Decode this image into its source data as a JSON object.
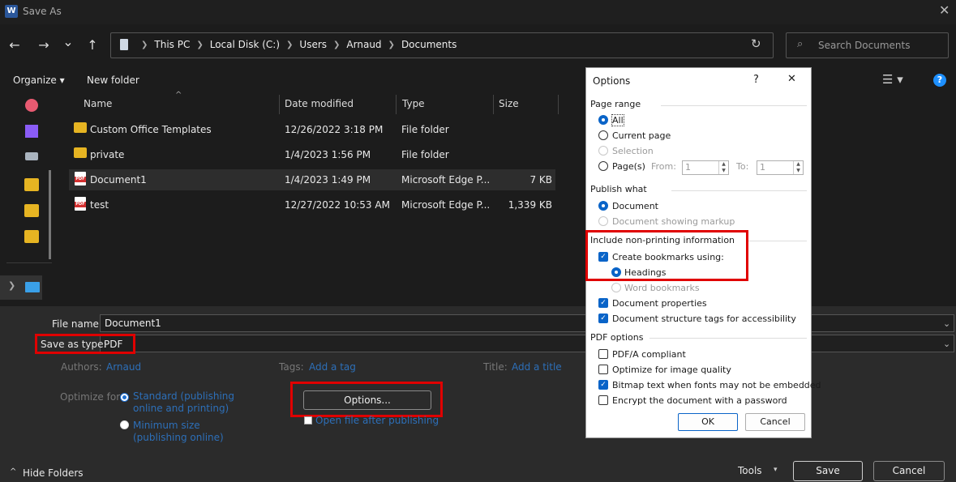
{
  "window": {
    "title": "Save As",
    "app_icon": "W"
  },
  "nav": {
    "back": "←",
    "forward": "→",
    "recent": "⌄",
    "up": "↑"
  },
  "address": {
    "crumbs": [
      "This PC",
      "Local Disk (C:)",
      "Users",
      "Arnaud",
      "Documents"
    ]
  },
  "search": {
    "placeholder": "Search Documents"
  },
  "toolbar": {
    "organize": "Organize ▾",
    "new_folder": "New folder"
  },
  "columns": {
    "name": "Name",
    "date": "Date modified",
    "type": "Type",
    "size": "Size"
  },
  "files": [
    {
      "name": "Custom Office Templates",
      "date": "12/26/2022 3:18 PM",
      "type": "File folder",
      "size": "",
      "icon": "folder-icon"
    },
    {
      "name": "private",
      "date": "1/4/2023 1:56 PM",
      "type": "File folder",
      "size": "",
      "icon": "folder-icon"
    },
    {
      "name": "Document1",
      "date": "1/4/2023 1:49 PM",
      "type": "Microsoft Edge P...",
      "size": "7 KB",
      "icon": "pdf-icon"
    },
    {
      "name": "test",
      "date": "12/27/2022 10:53 AM",
      "type": "Microsoft Edge P...",
      "size": "1,339 KB",
      "icon": "pdf-icon"
    }
  ],
  "form": {
    "file_name_label": "File name:",
    "file_name_value": "Document1",
    "save_type_label": "Save as type:",
    "save_type_value": "PDF",
    "authors_label": "Authors:",
    "authors_value": "Arnaud",
    "tags_label": "Tags:",
    "tags_value": "Add a tag",
    "title_label": "Title:",
    "title_value": "Add a title",
    "optimize_label": "Optimize for:",
    "optimize_standard_1": "Standard (publishing",
    "optimize_standard_2": "online and printing)",
    "optimize_min_1": "Minimum size",
    "optimize_min_2": "(publishing online)",
    "options_button": "Options...",
    "open_after": "Open file after publishing"
  },
  "footer": {
    "hide_folders": "Hide Folders",
    "tools": "Tools",
    "save": "Save",
    "cancel": "Cancel"
  },
  "options_dialog": {
    "title": "Options",
    "help": "?",
    "close": "✕",
    "page_range_head": "Page range",
    "all": "All",
    "current_page": "Current page",
    "selection": "Selection",
    "pages": "Page(s)",
    "from_label": "From:",
    "from_value": "1",
    "to_label": "To:",
    "to_value": "1",
    "publish_what_head": "Publish what",
    "document": "Document",
    "document_markup": "Document showing markup",
    "nonprinting_head": "Include non-printing information",
    "create_bookmarks": "Create bookmarks using:",
    "headings": "Headings",
    "word_bookmarks": "Word bookmarks",
    "doc_properties": "Document properties",
    "doc_structure": "Document structure tags for accessibility",
    "pdf_options_head": "PDF options",
    "pdfa": "PDF/A compliant",
    "optimize_image": "Optimize for image quality",
    "bitmap_text": "Bitmap text when fonts may not be embedded",
    "encrypt": "Encrypt the document with a password",
    "ok": "OK",
    "cancel": "Cancel"
  },
  "colors": {
    "accent": "#1e6fd0",
    "highlight_box": "#e00000",
    "link": "#2d6fb8",
    "folder": "#e6b422"
  }
}
